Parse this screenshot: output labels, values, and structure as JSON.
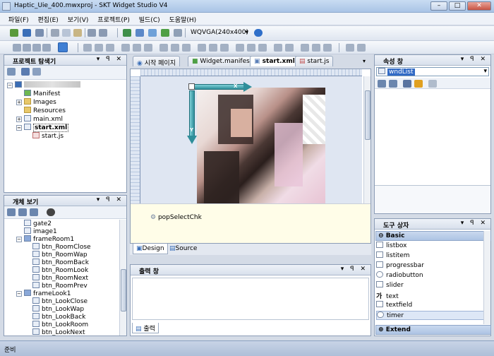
{
  "title": "Haptic_Uie_400.mwxproj - SKT Widget Studio V4",
  "window_buttons": {
    "minimize": "–",
    "maximize": "□",
    "close": "✕"
  },
  "menu": [
    "파일(F)",
    "편집(E)",
    "보기(V)",
    "프로젝트(P)",
    "빌드(C)",
    "도움말(H)"
  ],
  "toolbar": {
    "resolution": "WQVGA(240x400)"
  },
  "explorer": {
    "title": "프로젝트 탐색기",
    "items": [
      "Manifest",
      "Images",
      "Resources",
      "main.xml",
      "start.xml",
      "start.js"
    ]
  },
  "objects": {
    "title": "개체 보기",
    "items": [
      "gate2",
      "image1",
      "frameRoom1",
      "btn_RoomClose",
      "btn_RoomWap",
      "btn_RoomBack",
      "btn_RoomLook",
      "btn_RoomNext",
      "btn_RoomPrev",
      "frameLook1",
      "btn_LookClose",
      "btn_LookWap",
      "btn_LookBack",
      "btn_LookRoom",
      "btn_LookNext"
    ]
  },
  "editor": {
    "tabs": [
      "시작 페이지",
      "Widget.manifest",
      "start.xml",
      "start.js"
    ],
    "component": "popSelectChk",
    "arrow_x": "X",
    "arrow_y": "Y",
    "view_tabs": [
      "Design",
      "Source"
    ]
  },
  "output": {
    "title": "출력 창",
    "tab": "출력"
  },
  "properties": {
    "title": "속성 창",
    "selected": "wndList"
  },
  "toolbox": {
    "title": "도구 상자",
    "section_basic": "Basic",
    "items": [
      "listbox",
      "listitem",
      "progressbar",
      "radiobutton",
      "slider",
      "text",
      "textfield",
      "timer"
    ],
    "text_icon": "가",
    "section_extend": "Extend"
  },
  "status": "준비"
}
